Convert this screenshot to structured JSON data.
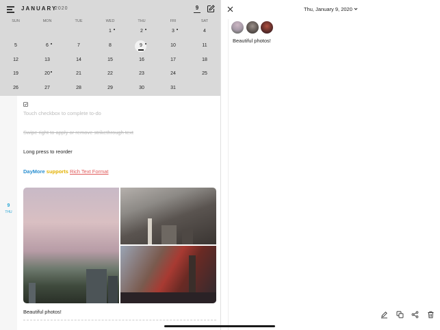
{
  "calendar": {
    "month": "JANUARY",
    "year": "2020",
    "today_number": "9",
    "weekdays": [
      "SUN",
      "MON",
      "TUE",
      "WED",
      "THU",
      "FRI",
      "SAT"
    ],
    "weeks": [
      [
        "",
        "",
        "",
        "1",
        "2",
        "3",
        "4"
      ],
      [
        "5",
        "6",
        "7",
        "8",
        "9",
        "10",
        "11"
      ],
      [
        "12",
        "13",
        "14",
        "15",
        "16",
        "17",
        "18"
      ],
      [
        "19",
        "20",
        "21",
        "22",
        "23",
        "24",
        "25"
      ],
      [
        "26",
        "27",
        "28",
        "29",
        "30",
        "31",
        ""
      ]
    ]
  },
  "timeline": {
    "day_number": "9",
    "day_label": "THU"
  },
  "note": {
    "hint_checkbox": "Touch checkbox to complete to-do",
    "hint_swipe": "Swipe right to apply or remove strikethrough text",
    "hint_reorder": "Long press to reorder",
    "rich_brand": "DayMore",
    "rich_supports": "supports",
    "rich_format": "Rich Text Format",
    "caption": "Beautiful photos!"
  },
  "detail": {
    "date": "Thu, January 9, 2020",
    "text": "Beautiful photos!"
  },
  "colors": {
    "calendar_bg": "#d9d9d9",
    "accent_blue": "#2aa7d6",
    "brand_blue": "#2a8fd0",
    "brand_yellow": "#e3b100",
    "brand_red": "#e05a5a"
  }
}
